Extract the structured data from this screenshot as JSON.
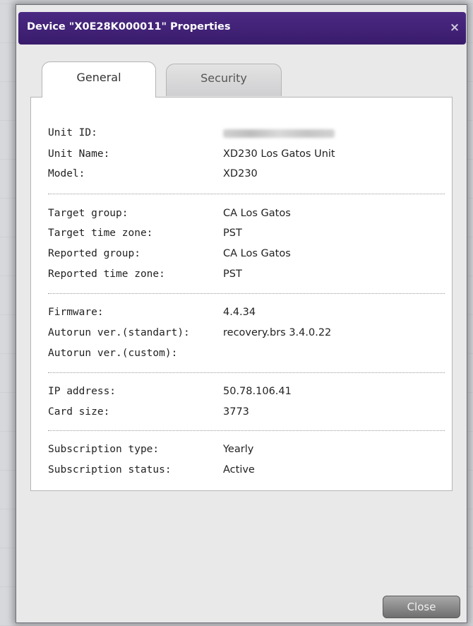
{
  "dialog": {
    "title": "Device \"X0E28K000011\" Properties",
    "close_icon": "close-icon"
  },
  "tabs": [
    {
      "label": "General",
      "active": true
    },
    {
      "label": "Security",
      "active": false
    }
  ],
  "general": {
    "unit": {
      "unit_id_label": "Unit ID:",
      "unit_name_label": "Unit Name:",
      "unit_name": "XD230 Los Gatos Unit",
      "model_label": "Model:",
      "model": "XD230"
    },
    "groups": {
      "target_group_label": "Target group:",
      "target_group": "CA Los Gatos",
      "target_tz_label": "Target time zone:",
      "target_tz": "PST",
      "reported_group_label": "Reported group:",
      "reported_group": "CA Los Gatos",
      "reported_tz_label": "Reported time zone:",
      "reported_tz": "PST"
    },
    "firmware": {
      "firmware_label": "Firmware:",
      "firmware": "4.4.34",
      "autorun_std_label": "Autorun ver.(standart):",
      "autorun_std": "recovery.brs 3.4.0.22",
      "autorun_custom_label": "Autorun ver.(custom):",
      "autorun_custom": ""
    },
    "network": {
      "ip_label": "IP address:",
      "ip": "50.78.106.41",
      "card_size_label": "Card size:",
      "card_size": "3773"
    },
    "subscription": {
      "type_label": "Subscription type:",
      "type": "Yearly",
      "status_label": "Subscription status:",
      "status": "Active"
    }
  },
  "footer": {
    "close_label": "Close"
  }
}
